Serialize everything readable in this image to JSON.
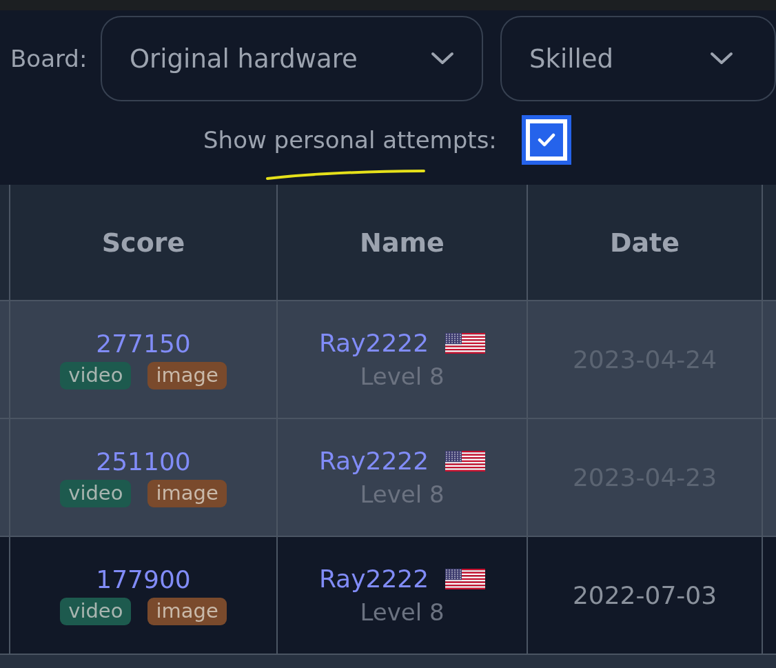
{
  "filters": {
    "board_label": "Board:",
    "dropdowns": [
      {
        "value": "Original hardware"
      },
      {
        "value": "Skilled"
      }
    ],
    "personal_toggle": {
      "label": "Show personal attempts:",
      "checked": true
    }
  },
  "table": {
    "columns": [
      "Score",
      "Name",
      "Date"
    ],
    "rows": [
      {
        "score": "277150",
        "tags": [
          {
            "label": "video",
            "kind": "video"
          },
          {
            "label": "image",
            "kind": "image"
          }
        ],
        "name": "Ray2222",
        "level": "Level 8",
        "date": "2023-04-24",
        "personal": true
      },
      {
        "score": "251100",
        "tags": [
          {
            "label": "video",
            "kind": "video"
          },
          {
            "label": "image",
            "kind": "image"
          }
        ],
        "name": "Ray2222",
        "level": "Level 8",
        "date": "2023-04-23",
        "personal": true
      },
      {
        "score": "177900",
        "tags": [
          {
            "label": "video",
            "kind": "video"
          },
          {
            "label": "image",
            "kind": "image"
          }
        ],
        "name": "Ray2222",
        "level": "Level 8",
        "date": "2022-07-03",
        "personal": false
      }
    ]
  }
}
